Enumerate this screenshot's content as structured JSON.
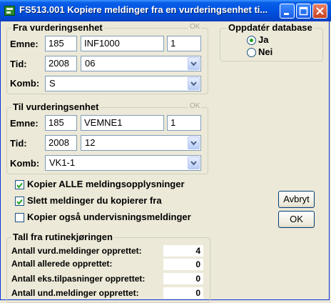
{
  "window": {
    "title": "FS513.001 Kopiere meldinger fra en vurderingsenhet ti..."
  },
  "from_section": {
    "title": "Fra vurderingsenhet",
    "ok_tag": "OK",
    "emne_label": "Emne:",
    "emne_institution": "185",
    "emne_code": "INF1000",
    "emne_version": "1",
    "tid_label": "Tid:",
    "tid_year": "2008",
    "tid_term": "06",
    "komb_label": "Komb:",
    "komb_value": "S"
  },
  "to_section": {
    "title": "Til vurderingsenhet",
    "ok_tag": "OK",
    "emne_label": "Emne:",
    "emne_institution": "185",
    "emne_code": "VEMNE1",
    "emne_version": "1",
    "tid_label": "Tid:",
    "tid_year": "2008",
    "tid_term": "12",
    "komb_label": "Komb:",
    "komb_value": "VK1-1"
  },
  "update_db": {
    "title": "Oppdatér database",
    "options": [
      "Ja",
      "Nei"
    ],
    "selected": "Ja"
  },
  "options": {
    "copy_all_label": "Kopier ALLE meldingsopplysninger",
    "copy_all_checked": true,
    "delete_label": "Slett  meldinger du kopierer fra",
    "delete_checked": true,
    "copy_teaching_label": "Kopier også undervisningsmeldinger",
    "copy_teaching_checked": false
  },
  "buttons": {
    "cancel": "Avbryt",
    "ok": "OK"
  },
  "results": {
    "title": "Tall fra rutinekjøringen",
    "rows": [
      {
        "label": "Antall vurd.meldinger opprettet:",
        "value": "4"
      },
      {
        "label": "Antall allerede opprettet:",
        "value": "0"
      },
      {
        "label": "Antall eks.tilpasninger opprettet:",
        "value": "0"
      },
      {
        "label": "Antall und.meldinger opprettet:",
        "value": "0"
      }
    ]
  }
}
